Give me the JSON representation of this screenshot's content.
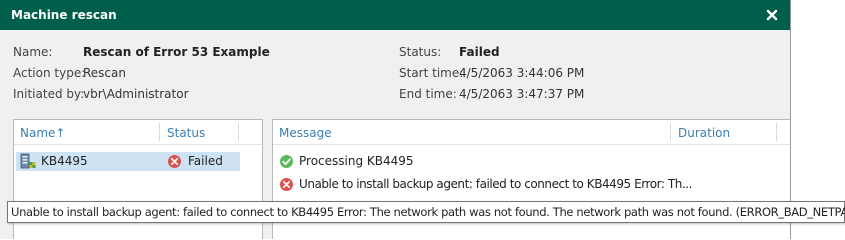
{
  "dialog": {
    "title": "Machine rescan",
    "close_symbol": "×"
  },
  "details": {
    "name_label": "Name:",
    "name_value": "Rescan of Error 53 Example",
    "action_type_label": "Action type:",
    "action_type_value": "Rescan",
    "initiated_by_label": "Initiated by:",
    "initiated_by_value": "vbr\\Administrator",
    "status_label": "Status:",
    "status_value": "Failed",
    "start_time_label": "Start time:",
    "start_time_value": "4/5/2063 3:44:06 PM",
    "end_time_label": "End time:",
    "end_time_value": "4/5/2063 3:47:37 PM"
  },
  "machines_grid": {
    "columns": {
      "name": "Name",
      "name_sort_arrow": "↑",
      "status": "Status"
    },
    "rows": [
      {
        "name": "KB4495",
        "status": "Failed",
        "icon": "server-icon",
        "status_icon": "error-icon"
      }
    ]
  },
  "log_grid": {
    "columns": {
      "message": "Message",
      "duration": "Duration"
    },
    "rows": [
      {
        "message": "Processing KB4495",
        "icon": "success-icon"
      },
      {
        "message": "Unable to install backup agent: failed to connect to KB4495 Error: Th...",
        "icon": "error-icon"
      }
    ]
  },
  "tooltip": {
    "text": "Unable to install backup agent: failed to connect to KB4495 Error: The network path was not found. The network path was not found. (ERROR_BAD_NETPATH)."
  },
  "colors": {
    "titlebar": "#005f4b",
    "header_link": "#3c7fb1",
    "selection": "#cde3f4",
    "error": "#d9534f",
    "success": "#5cb85c"
  }
}
